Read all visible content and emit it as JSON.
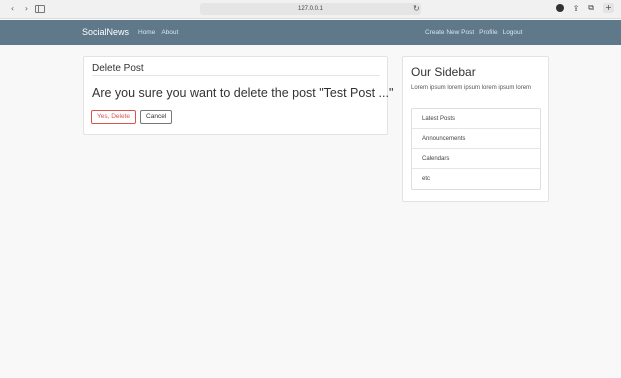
{
  "browser": {
    "url": "127.0.0.1",
    "icons": {
      "back": "chevron-left-icon",
      "forward": "chevron-right-icon",
      "sidebar": "sidebar-icon",
      "reload": "reload-icon",
      "share": "share-icon",
      "tabs": "tabs-icon",
      "new_tab": "plus-icon"
    }
  },
  "navbar": {
    "brand": "SocialNews",
    "left_links": [
      "Home",
      "About"
    ],
    "right_links": [
      "Create New Post",
      "Profile",
      "Logout"
    ],
    "color": "#5f788a"
  },
  "delete_post": {
    "legend": "Delete Post",
    "question": "Are you sure you want to delete the post \"Test Post ...\"",
    "confirm_label": "Yes, Delete",
    "cancel_label": "Cancel",
    "danger_color": "#d9534f"
  },
  "sidebar": {
    "title": "Our Sidebar",
    "text": "Lorem ipsum lorem ipsum lorem ipsum lorem",
    "items": [
      "Latest Posts",
      "Announcements",
      "Calendars",
      "etc"
    ]
  }
}
